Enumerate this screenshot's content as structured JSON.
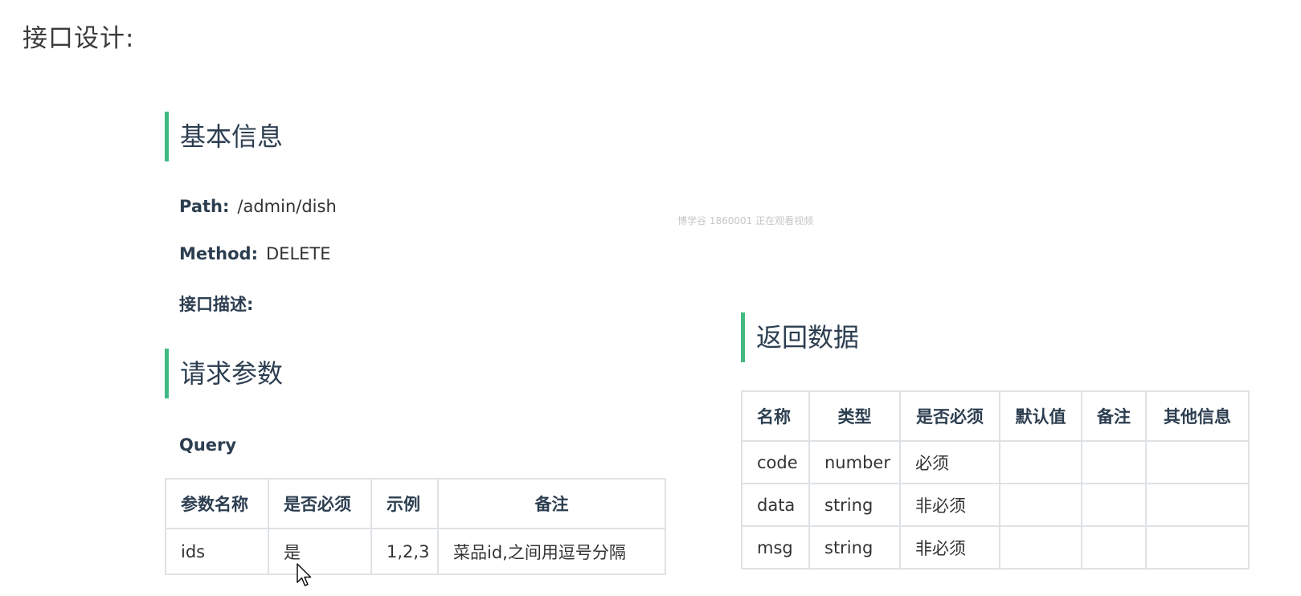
{
  "page": {
    "title": "接口设计:"
  },
  "watermark": "博学谷 1860001 正在观看视频",
  "basic_info": {
    "heading": "基本信息",
    "path_label": "Path:",
    "path_value": "/admin/dish",
    "method_label": "Method:",
    "method_value": "DELETE",
    "desc_label": "接口描述:"
  },
  "request": {
    "heading": "请求参数",
    "query_label": "Query",
    "columns": [
      "参数名称",
      "是否必须",
      "示例",
      "备注"
    ],
    "rows": [
      [
        "ids",
        "是",
        "1,2,3",
        "菜品id,之间用逗号分隔"
      ]
    ]
  },
  "response": {
    "heading": "返回数据",
    "columns": [
      "名称",
      "类型",
      "是否必须",
      "默认值",
      "备注",
      "其他信息"
    ],
    "rows": [
      [
        "code",
        "number",
        "必须",
        "",
        "",
        ""
      ],
      [
        "data",
        "string",
        "非必须",
        "",
        "",
        ""
      ],
      [
        "msg",
        "string",
        "非必须",
        "",
        "",
        ""
      ]
    ]
  },
  "colors": {
    "accent": "#42b983",
    "table_border": "#dfe2e5",
    "heading_text": "#2c3e50"
  }
}
